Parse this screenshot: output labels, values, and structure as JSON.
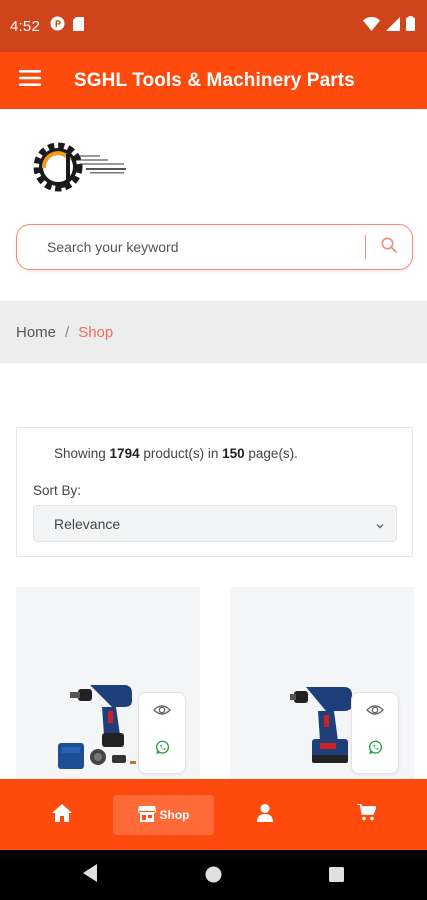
{
  "status_bar": {
    "time": "4:52"
  },
  "app_bar": {
    "title": "SGHL Tools & Machinery Parts"
  },
  "logo": {
    "label": "SGHL logo"
  },
  "search": {
    "placeholder": "Search your keyword"
  },
  "breadcrumb": {
    "home": "Home",
    "separator": "/",
    "current": "Shop"
  },
  "results": {
    "prefix": "Showing ",
    "product_count": "1794",
    "middle": " product(s) in ",
    "page_count": "150",
    "suffix": " page(s).",
    "sort_label": "Sort By:",
    "sort_value": "Relevance"
  },
  "products": [
    {
      "image": "cordless-drill-kit-image"
    },
    {
      "image": "cordless-drill-image"
    }
  ],
  "bottom_nav": {
    "shop_label": "Shop"
  },
  "colors": {
    "status_bar": "#d0441c",
    "primary": "#fe4a0d",
    "accent_text": "#f26b5e",
    "whatsapp": "#25a244"
  }
}
